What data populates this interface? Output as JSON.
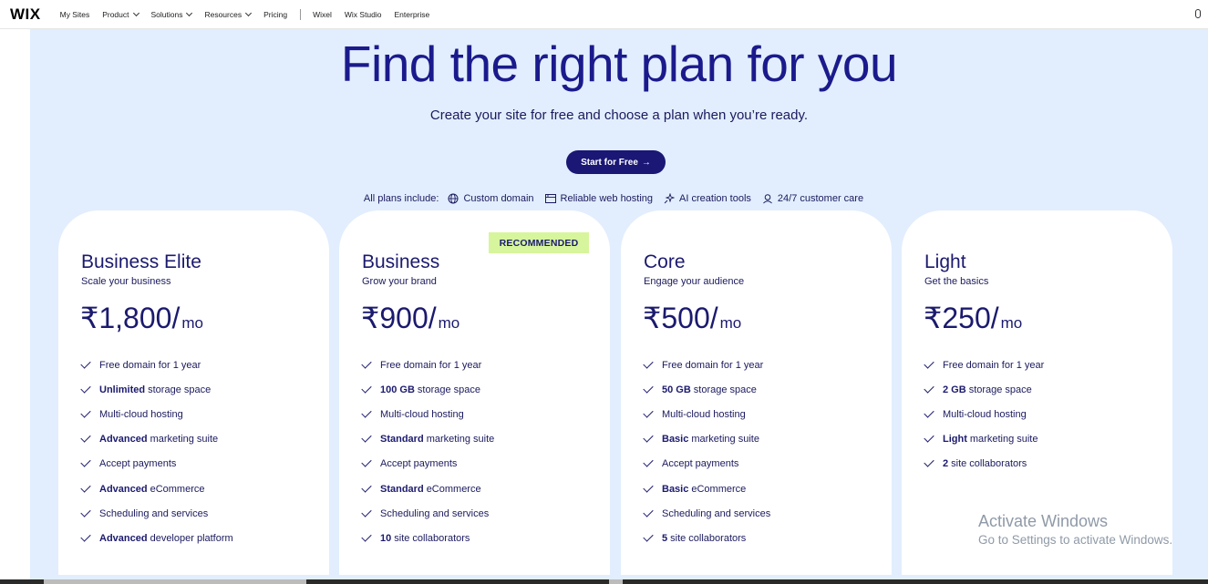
{
  "nav": {
    "logo": "WIX",
    "items": [
      {
        "label": "My Sites",
        "has_dropdown": false
      },
      {
        "label": "Product",
        "has_dropdown": true
      },
      {
        "label": "Solutions",
        "has_dropdown": true
      },
      {
        "label": "Resources",
        "has_dropdown": true
      },
      {
        "label": "Pricing",
        "has_dropdown": false
      }
    ],
    "secondary": [
      "Wixel",
      "Wix Studio",
      "Enterprise"
    ]
  },
  "hero": {
    "title": "Find the right plan for you",
    "subtitle": "Create your site for free and choose a plan when you’re ready.",
    "cta_label": "Start for Free",
    "cta_arrow": "→",
    "includes_lead": "All plans include:",
    "includes": [
      {
        "icon": "globe-icon",
        "label": "Custom domain"
      },
      {
        "icon": "server-icon",
        "label": "Reliable web hosting"
      },
      {
        "icon": "sparkle-icon",
        "label": "AI creation tools"
      },
      {
        "icon": "support-agent-icon",
        "label": "24/7 customer care"
      }
    ]
  },
  "plans": [
    {
      "name": "Business Elite",
      "tagline": "Scale your business",
      "price": "₹1,800/",
      "per": "mo",
      "recommended": false,
      "features": [
        {
          "bold": "",
          "text": "Free domain for 1 year"
        },
        {
          "bold": "Unlimited",
          "text": "storage space"
        },
        {
          "bold": "",
          "text": "Multi-cloud hosting"
        },
        {
          "bold": "Advanced",
          "text": "marketing suite"
        },
        {
          "bold": "",
          "text": "Accept payments"
        },
        {
          "bold": "Advanced",
          "text": "eCommerce"
        },
        {
          "bold": "",
          "text": "Scheduling and services"
        },
        {
          "bold": "Advanced",
          "text": "developer platform"
        }
      ]
    },
    {
      "name": "Business",
      "tagline": "Grow your brand",
      "price": "₹900/",
      "per": "mo",
      "recommended": true,
      "recommended_label": "RECOMMENDED",
      "features": [
        {
          "bold": "",
          "text": "Free domain for 1 year"
        },
        {
          "bold": "100 GB",
          "text": "storage space"
        },
        {
          "bold": "",
          "text": "Multi-cloud hosting"
        },
        {
          "bold": "Standard",
          "text": "marketing suite"
        },
        {
          "bold": "",
          "text": "Accept payments"
        },
        {
          "bold": "Standard",
          "text": "eCommerce"
        },
        {
          "bold": "",
          "text": "Scheduling and services"
        },
        {
          "bold": "10",
          "text": "site collaborators"
        }
      ]
    },
    {
      "name": "Core",
      "tagline": "Engage your audience",
      "price": "₹500/",
      "per": "mo",
      "recommended": false,
      "features": [
        {
          "bold": "",
          "text": "Free domain for 1 year"
        },
        {
          "bold": "50 GB",
          "text": "storage space"
        },
        {
          "bold": "",
          "text": "Multi-cloud hosting"
        },
        {
          "bold": "Basic",
          "text": "marketing suite"
        },
        {
          "bold": "",
          "text": "Accept payments"
        },
        {
          "bold": "Basic",
          "text": "eCommerce"
        },
        {
          "bold": "",
          "text": "Scheduling and services"
        },
        {
          "bold": "5",
          "text": "site collaborators"
        }
      ]
    },
    {
      "name": "Light",
      "tagline": "Get the basics",
      "price": "₹250/",
      "per": "mo",
      "recommended": false,
      "features": [
        {
          "bold": "",
          "text": "Free domain for 1 year"
        },
        {
          "bold": "2 GB",
          "text": "storage space"
        },
        {
          "bold": "",
          "text": "Multi-cloud hosting"
        },
        {
          "bold": "Light",
          "text": "marketing suite"
        },
        {
          "bold": "2",
          "text": "site collaborators"
        }
      ]
    }
  ],
  "watermark": {
    "line1": "Activate Windows",
    "line2": "Go to Settings to activate Windows."
  }
}
